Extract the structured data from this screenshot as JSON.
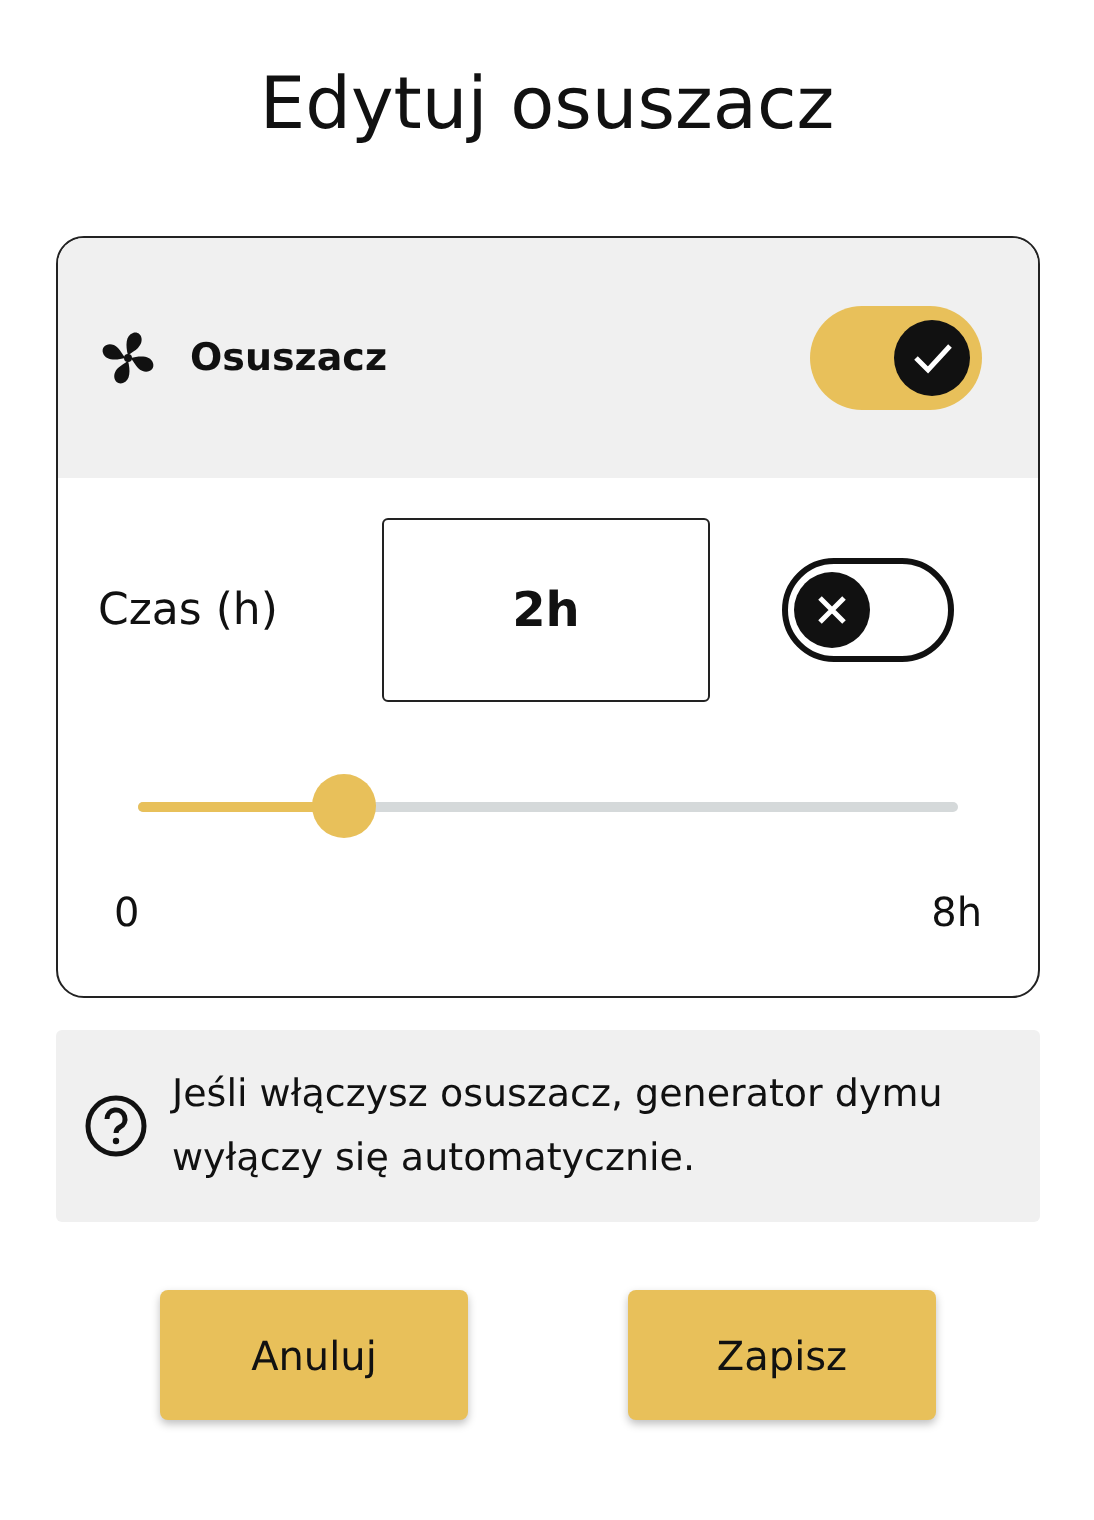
{
  "title": "Edytuj osuszacz",
  "device": {
    "name": "Osuszacz",
    "on": true
  },
  "time": {
    "label": "Czas (h)",
    "value": "2h",
    "toggle_on": false
  },
  "slider": {
    "level": 0.25,
    "min_label": "0",
    "max_label": "8h"
  },
  "info": "Jeśli włączysz osuszacz, generator dymu wyłączy się automatycznie.",
  "buttons": [
    {
      "label": "Anuluj"
    },
    {
      "label": "Zapisz"
    }
  ]
}
